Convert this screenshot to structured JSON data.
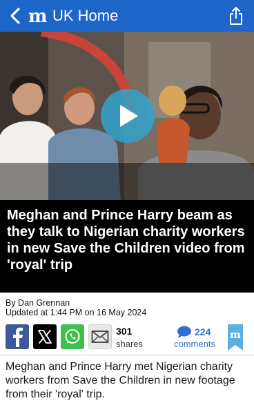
{
  "header": {
    "title": "UK Home",
    "icons": {
      "back": "chevron-left-icon",
      "logo": "mail-logo",
      "share": "share-icon"
    },
    "background_color": "#1f66c9"
  },
  "video": {
    "play_icon": "play-icon",
    "play_color": "#33a3cc"
  },
  "article": {
    "headline": "Meghan and Prince Harry beam as they talk to Nigerian charity workers in new Save the Children video from 'royal' trip",
    "byline": "By Dan Grennan",
    "updated": "Updated at 1:44 PM on 16 May 2024",
    "summary": "Meghan and Prince Harry met Nigerian charity workers from Save the Children in new footage from their 'royal' trip."
  },
  "social": {
    "icons": [
      "facebook-icon",
      "x-icon",
      "whatsapp-icon",
      "email-icon"
    ],
    "shares_count": "301",
    "shares_label": "shares",
    "comments_count": "224",
    "comments_label": "comments",
    "bookmark_icon": "bookmark-icon",
    "accent_color": "#2f6ed2"
  }
}
